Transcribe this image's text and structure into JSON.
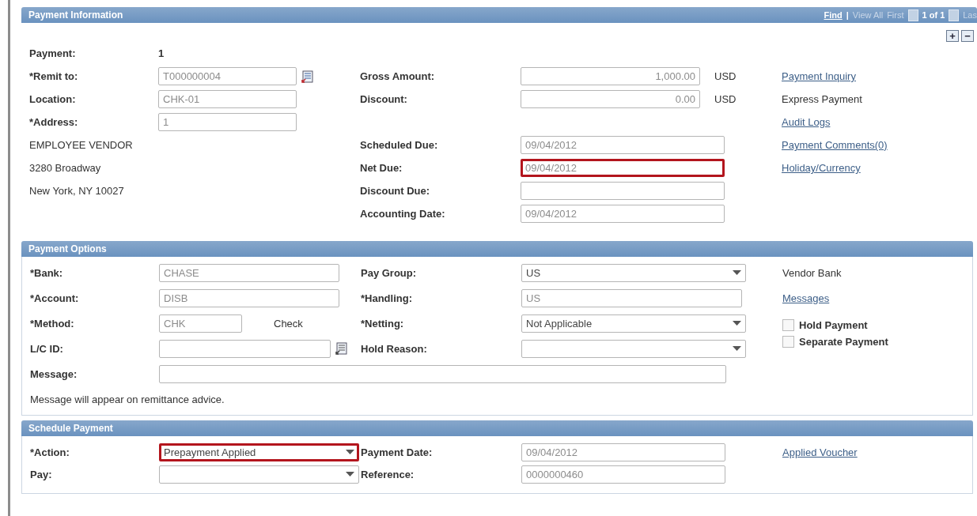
{
  "payment_information": {
    "title": "Payment Information",
    "nav": [
      {
        "kind": "link",
        "label": "Find"
      },
      {
        "kind": "separator",
        "label": "|"
      },
      {
        "kind": "disabled",
        "label": "View All"
      },
      {
        "kind": "disabled",
        "label": "First"
      },
      {
        "kind": "prev-icon"
      },
      {
        "kind": "count",
        "label": "1 of 1"
      },
      {
        "kind": "next-icon"
      },
      {
        "kind": "disabled",
        "label": "Las"
      }
    ],
    "row_buttons": [
      "+",
      "−"
    ],
    "payment": {
      "label": "Payment:",
      "value": "1"
    },
    "fields": [
      {
        "label": "*Remit to:",
        "value": "T000000004",
        "lookup": true
      },
      {
        "label": "Location:",
        "value": "CHK-01"
      },
      {
        "label": "*Address:",
        "value": "1"
      }
    ],
    "address_lines": [
      "EMPLOYEE VENDOR",
      "3280 Broadway",
      "New York, NY  10027"
    ],
    "amounts": [
      {
        "label": "Gross Amount:",
        "value": "1,000.00",
        "currency": "USD"
      },
      {
        "label": "Discount:",
        "value": "0.00",
        "currency": "USD"
      }
    ],
    "dates": [
      {
        "label": "Scheduled Due:",
        "value": "09/04/2012",
        "highlighted": false
      },
      {
        "label": "Net Due:",
        "value": "09/04/2012",
        "highlighted": true
      },
      {
        "label": "Discount Due:",
        "highlighted": false
      },
      {
        "label": "Accounting Date:",
        "value": "09/04/2012",
        "highlighted": false
      }
    ],
    "links": [
      {
        "kind": "link",
        "label": "Payment Inquiry"
      },
      {
        "kind": "text",
        "label": "Express Payment"
      },
      {
        "kind": "link",
        "label": "Audit Logs"
      },
      {
        "kind": "link",
        "label": "Payment Comments(0)"
      },
      {
        "kind": "link",
        "label": "Holiday/Currency"
      }
    ]
  },
  "payment_options": {
    "title": "Payment Options",
    "fields": [
      {
        "label": "*Bank:",
        "kind": "input",
        "value": "CHASE"
      },
      {
        "label": "*Account:",
        "kind": "input",
        "value": "DISB"
      },
      {
        "label": "*Method:",
        "kind": "input",
        "value": "CHK",
        "description": "Check"
      },
      {
        "label": "L/C ID:",
        "kind": "lookup"
      }
    ],
    "fields_2": [
      {
        "label": "Pay Group:",
        "kind": "select",
        "value": "US"
      },
      {
        "label": "*Handling:",
        "kind": "input",
        "value": "US"
      },
      {
        "label": "*Netting:",
        "kind": "select",
        "value": "Not Applicable"
      },
      {
        "label": "Hold Reason:",
        "kind": "select"
      }
    ],
    "message": {
      "label": "Message:",
      "note": "Message will appear on remittance advice."
    },
    "side": [
      {
        "kind": "text",
        "label": "Vendor Bank"
      },
      {
        "kind": "link",
        "label": "Messages"
      }
    ],
    "checkboxes": [
      {
        "label": "Hold Payment",
        "checked": false
      },
      {
        "label": "Separate Payment",
        "checked": false
      }
    ]
  },
  "schedule_payment": {
    "title": "Schedule Payment",
    "fields": [
      {
        "label": "*Action:",
        "kind": "select",
        "value": "Prepayment Applied",
        "highlighted": true
      },
      {
        "label": "Pay:",
        "kind": "select",
        "highlighted": false
      }
    ],
    "fields_2": [
      {
        "label": "Payment Date:",
        "value": "09/04/2012"
      },
      {
        "label": "Reference:",
        "value": "0000000460"
      }
    ],
    "links": [
      {
        "kind": "link",
        "label": "Applied Voucher"
      }
    ]
  }
}
